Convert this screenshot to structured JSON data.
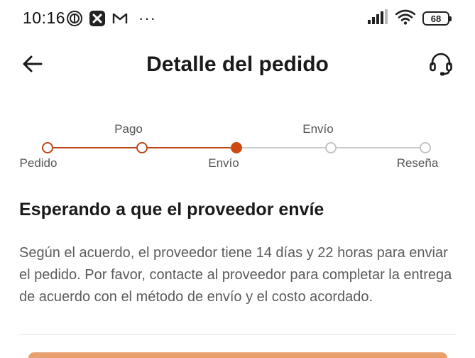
{
  "status_bar": {
    "time": "10:16",
    "more_indicator": "···",
    "battery_level": "68",
    "icons": [
      "notification-app-icon",
      "app-x-icon",
      "gmail-icon",
      "signal-icon",
      "wifi-icon",
      "battery-icon"
    ]
  },
  "header": {
    "title": "Detalle del pedido",
    "back_icon": "arrow-left-icon",
    "support_icon": "headset-icon"
  },
  "tracker": {
    "steps": [
      {
        "label": "Pedido",
        "position": "below",
        "state": "done"
      },
      {
        "label": "Pago",
        "position": "above",
        "state": "done"
      },
      {
        "label": "Envío",
        "position": "below",
        "state": "current"
      },
      {
        "label": "Envío",
        "position": "above",
        "state": "pending"
      },
      {
        "label": "Reseña",
        "position": "below",
        "state": "pending"
      }
    ]
  },
  "status": {
    "heading": "Esperando a que el proveedor envíe",
    "description": "Según el acuerdo, el proveedor tiene 14 días y 22 horas para enviar el pedido. Por favor, contacte al proveedor para completar la entrega de acuerdo con el método de envío y el costo acordado."
  },
  "colors": {
    "accent": "#cf4812",
    "done_line": "#b9471a",
    "pending": "#c4c4c4"
  }
}
